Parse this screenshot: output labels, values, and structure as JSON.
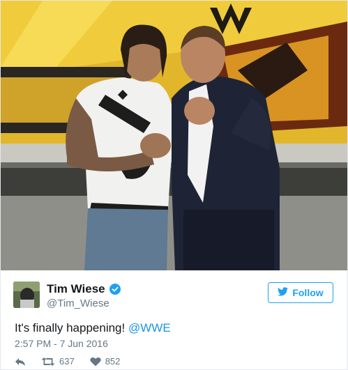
{
  "tweet": {
    "user": {
      "name": "Tim Wiese",
      "handle": "@Tim_Wiese",
      "verified": true
    },
    "follow_label": "Follow",
    "text_before": "It's finally happening! ",
    "mention": "@WWE",
    "timestamp": "2:57 PM - 7 Jun 2016",
    "retweets": "637",
    "likes": "852"
  },
  "colors": {
    "accent": "#1da1f2",
    "text": "#14171a",
    "muted": "#657786",
    "mention": "#1b95e0"
  },
  "icons": {
    "reply": "reply-icon",
    "retweet": "retweet-icon",
    "like": "heart-icon",
    "follow": "twitter-bird-icon",
    "verified": "verified-badge-icon"
  }
}
